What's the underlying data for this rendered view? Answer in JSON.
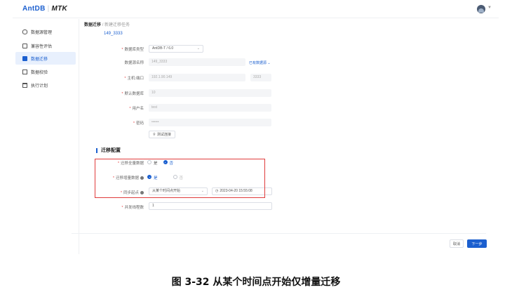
{
  "app": {
    "logo_left": "AntDB",
    "logo_right": "MTK"
  },
  "sidebar": {
    "items": [
      {
        "label": "数据源管理",
        "icon": "database-icon"
      },
      {
        "label": "兼容性评估",
        "icon": "document-icon"
      },
      {
        "label": "数据迁移",
        "icon": "folder-icon"
      },
      {
        "label": "数据校验",
        "icon": "copy-icon"
      },
      {
        "label": "执行计划",
        "icon": "calendar-icon"
      }
    ],
    "active_index": 2
  },
  "breadcrumb": {
    "root": "数据迁移",
    "separator": "/",
    "current": "新建迁移任务"
  },
  "subtitle": "149_3333",
  "form": {
    "db_type": {
      "label": "数据库类型",
      "value": "AntDB-T / 6.0"
    },
    "db_name": {
      "label": "数据源名称",
      "value": "149_3333",
      "link": "已有数据源"
    },
    "host_port": {
      "label": "主机:端口",
      "host": "192.1.90.149",
      "port": "3333"
    },
    "default_db": {
      "label": "默认数据库",
      "value": "10"
    },
    "username": {
      "label": "用户名",
      "value": "test"
    },
    "password": {
      "label": "密码",
      "value": "••••••"
    },
    "test_button": "测试连接"
  },
  "migration": {
    "section_title": "迁移配置",
    "full_data": {
      "label": "迁移全量数据",
      "options": [
        "是",
        "否"
      ],
      "selected": "否"
    },
    "incremental": {
      "label": "迁移增量数据",
      "options": [
        "是",
        "否"
      ],
      "selected": "是"
    },
    "sync_point": {
      "label": "同步起点",
      "mode": "从某个时间点开始",
      "datetime": "2023-04-20 15:55:08"
    },
    "parallelism": {
      "label": "并发线程数",
      "value": "1"
    }
  },
  "footer": {
    "cancel": "取消",
    "next": "下一步"
  },
  "caption": "图 3-32  从某个时间点开始仅增量迁移",
  "colors": {
    "accent": "#1b5fcf",
    "highlight_box": "#e03c3c"
  }
}
